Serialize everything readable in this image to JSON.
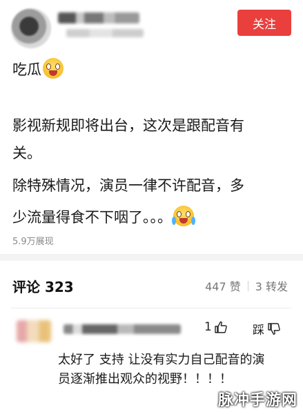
{
  "header": {
    "follow_label": "关注"
  },
  "post": {
    "line1": "吃瓜",
    "line2": "影视新规即将出台，这次是跟配音有",
    "line3": "关。",
    "line4": "除特殊情况，演员一律不许配音，多",
    "line5": "少流量得食不下咽了。。。",
    "views": "5.9万展现"
  },
  "comments": {
    "title": "评论 323",
    "likes": "447 赞",
    "reposts": "3 转发",
    "items": [
      {
        "like_count": "1",
        "dislike_label": "踩",
        "text": "太好了 支持 让没有实力自己配音的演员逐渐推出观众的视野！！！！"
      }
    ]
  },
  "watermark": "脉冲手游网",
  "colors": {
    "follow_button": "#e9403e",
    "muted_text": "#8a8a8a"
  }
}
